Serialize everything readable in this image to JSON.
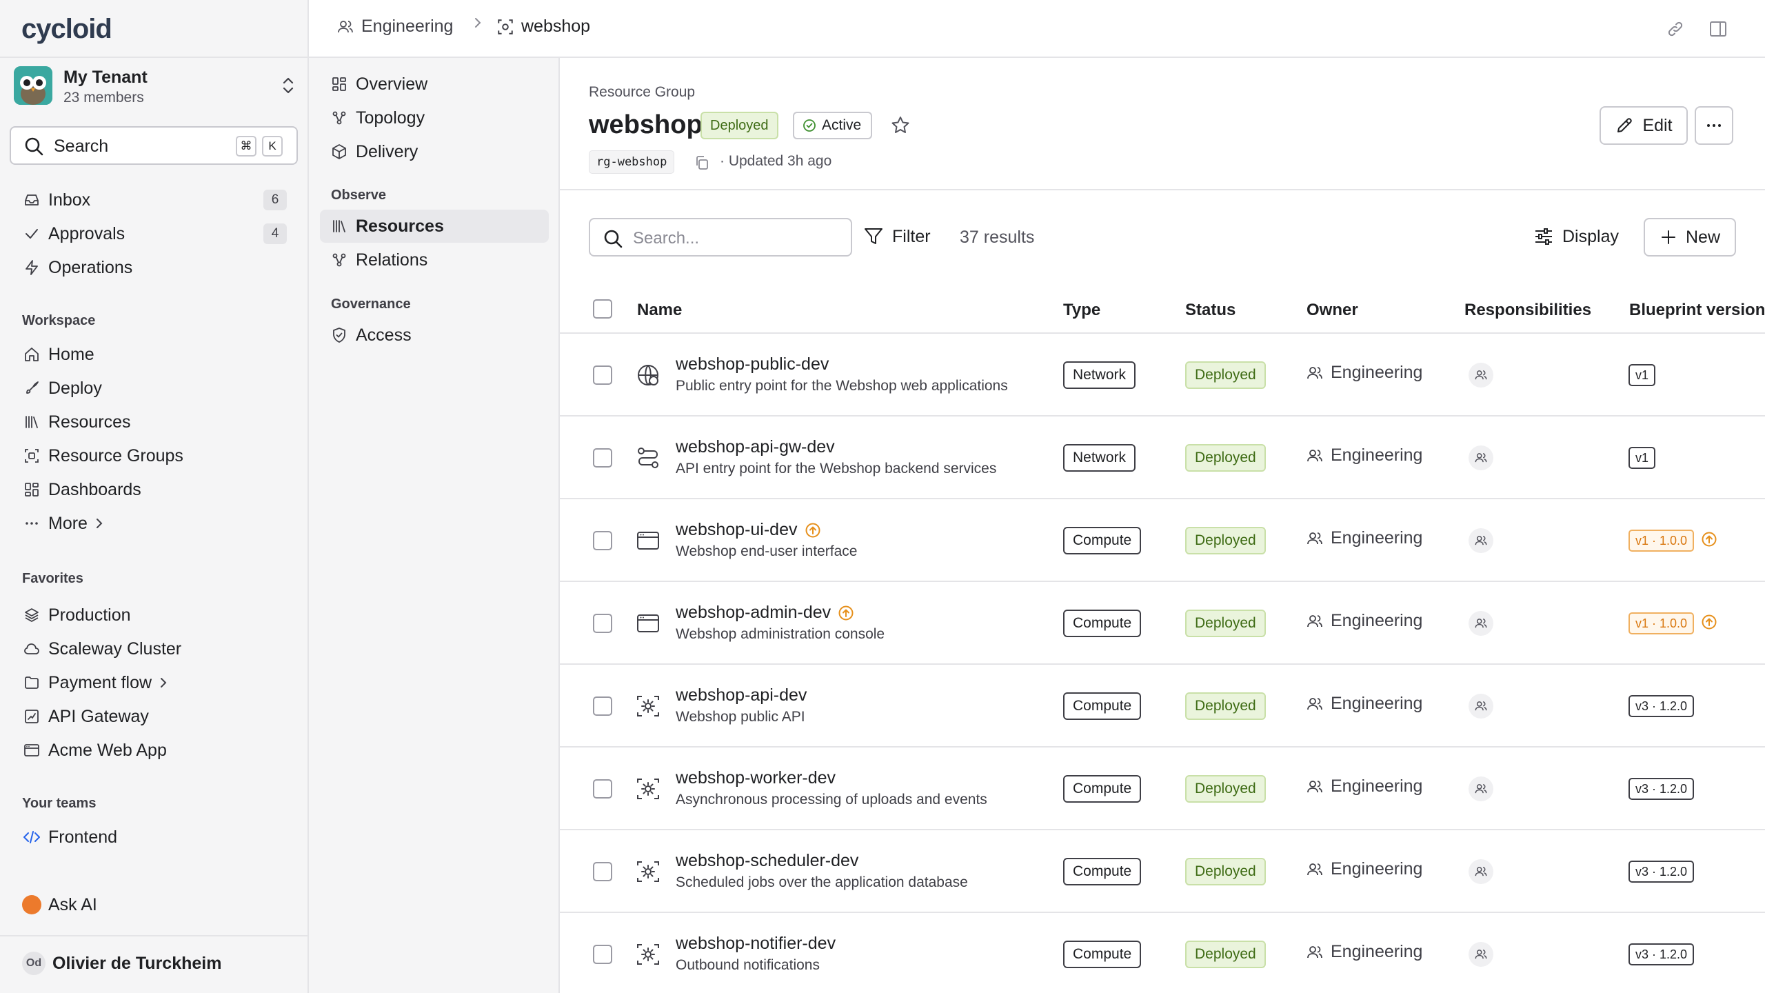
{
  "app": {
    "logo": "cycloid"
  },
  "tenant": {
    "name": "My Tenant",
    "members": "23 members"
  },
  "search": {
    "label": "Search",
    "kbd_1": "⌘",
    "kbd_2": "K"
  },
  "sidebar": {
    "top_items": [
      {
        "label": "Inbox",
        "badge": "6",
        "icon": "inbox-icon"
      },
      {
        "label": "Approvals",
        "badge": "4",
        "icon": "check-icon"
      },
      {
        "label": "Operations",
        "badge": "",
        "icon": "bolt-icon"
      }
    ],
    "workspace_label": "Workspace",
    "workspace_items": [
      {
        "label": "Home",
        "icon": "home-icon"
      },
      {
        "label": "Deploy",
        "icon": "rocket-icon"
      },
      {
        "label": "Resources",
        "icon": "library-icon"
      },
      {
        "label": "Resource Groups",
        "icon": "group-icon"
      },
      {
        "label": "Dashboards",
        "icon": "dashboard-icon"
      },
      {
        "label": "More",
        "icon": "dots-icon"
      }
    ],
    "favorites_label": "Favorites",
    "favorites": [
      {
        "label": "Production",
        "icon": "layers-icon"
      },
      {
        "label": "Scaleway Cluster",
        "icon": "cloud-icon"
      },
      {
        "label": "Payment flow",
        "icon": "folder-icon"
      },
      {
        "label": "API Gateway",
        "icon": "square-pulse-icon"
      },
      {
        "label": "Acme Web App",
        "icon": "browser-icon"
      }
    ],
    "teams_label": "Your teams",
    "teams": [
      {
        "label": "Frontend",
        "icon": "code-icon"
      }
    ],
    "ask_ai": "Ask AI",
    "user": {
      "initials": "Od",
      "name": "Olivier de Turckheim"
    }
  },
  "breadcrumb": {
    "team": "Engineering",
    "current": "webshop"
  },
  "subnav": {
    "top_items": [
      {
        "label": "Overview",
        "icon": "dashboard-icon"
      },
      {
        "label": "Topology",
        "icon": "topology-icon"
      },
      {
        "label": "Delivery",
        "icon": "package-icon"
      }
    ],
    "observe_label": "Observe",
    "observe_items": [
      {
        "label": "Resources",
        "icon": "library-icon"
      },
      {
        "label": "Relations",
        "icon": "topology-icon"
      }
    ],
    "governance_label": "Governance",
    "governance_items": [
      {
        "label": "Access",
        "icon": "shield-check-icon"
      }
    ]
  },
  "header": {
    "kicker": "Resource Group",
    "title": "webshop",
    "status_deployed": "Deployed",
    "status_active": "Active",
    "slug": "rg-webshop",
    "updated": "·  Updated 3h ago",
    "edit_label": "Edit"
  },
  "toolbar": {
    "search_placeholder": "Search...",
    "filter_label": "Filter",
    "results": "37 results",
    "display_label": "Display",
    "new_label": "New"
  },
  "table": {
    "columns": [
      "Name",
      "Type",
      "Status",
      "Owner",
      "Responsibilities",
      "Blueprint version"
    ],
    "rows": [
      {
        "name": "webshop-public-dev",
        "desc": "Public entry point for the Webshop web applications",
        "icon": "globe-network-icon",
        "update": false,
        "type": "Network",
        "status": "Deployed",
        "owner": "Engineering",
        "version": "v1",
        "version_warn": false
      },
      {
        "name": "webshop-api-gw-dev",
        "desc": "API entry point for the Webshop backend services",
        "icon": "route-icon",
        "update": false,
        "type": "Network",
        "status": "Deployed",
        "owner": "Engineering",
        "version": "v1",
        "version_warn": false
      },
      {
        "name": "webshop-ui-dev",
        "desc": "Webshop end-user interface",
        "icon": "browser-icon",
        "update": true,
        "type": "Compute",
        "status": "Deployed",
        "owner": "Engineering",
        "version": "v1 · 1.0.0",
        "version_warn": true
      },
      {
        "name": "webshop-admin-dev",
        "desc": "Webshop administration console",
        "icon": "browser-icon",
        "update": true,
        "type": "Compute",
        "status": "Deployed",
        "owner": "Engineering",
        "version": "v1 · 1.0.0",
        "version_warn": true
      },
      {
        "name": "webshop-api-dev",
        "desc": "Webshop public API",
        "icon": "server-gear-icon",
        "update": false,
        "type": "Compute",
        "status": "Deployed",
        "owner": "Engineering",
        "version": "v3 · 1.2.0",
        "version_warn": false
      },
      {
        "name": "webshop-worker-dev",
        "desc": "Asynchronous processing of uploads and events",
        "icon": "server-gear-icon",
        "update": false,
        "type": "Compute",
        "status": "Deployed",
        "owner": "Engineering",
        "version": "v3 · 1.2.0",
        "version_warn": false
      },
      {
        "name": "webshop-scheduler-dev",
        "desc": "Scheduled jobs over the application database",
        "icon": "server-gear-icon",
        "update": false,
        "type": "Compute",
        "status": "Deployed",
        "owner": "Engineering",
        "version": "v3 · 1.2.0",
        "version_warn": false
      },
      {
        "name": "webshop-notifier-dev",
        "desc": "Outbound notifications",
        "icon": "server-gear-icon",
        "update": false,
        "type": "Compute",
        "status": "Deployed",
        "owner": "Engineering",
        "version": "v3 · 1.2.0",
        "version_warn": false
      }
    ]
  },
  "colors": {
    "accent_orange": "#ec7a2c",
    "deployed_green": "#3e6b14",
    "warn_orange": "#d9770f",
    "team_blue": "#2563eb"
  }
}
